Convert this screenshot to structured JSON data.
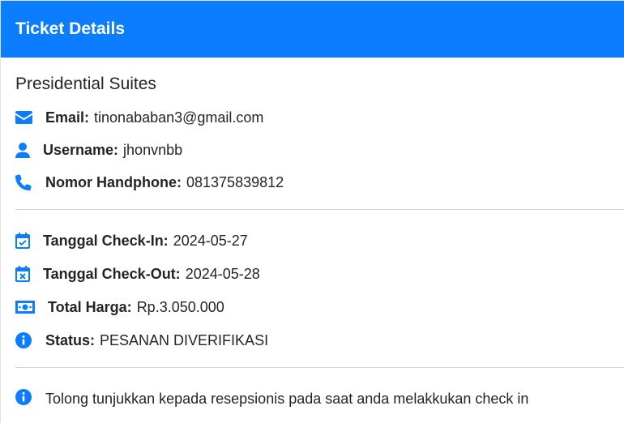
{
  "header": {
    "title": "Ticket Details"
  },
  "hotel": {
    "name": "Presidential Suites"
  },
  "contact": [
    {
      "icon": "envelope-icon",
      "label": "Email:",
      "value": "tinonababan3@gmail.com"
    },
    {
      "icon": "user-icon",
      "label": "Username:",
      "value": "jhonvnbb"
    },
    {
      "icon": "phone-icon",
      "label": "Nomor Handphone:",
      "value": "081375839812"
    }
  ],
  "booking": [
    {
      "icon": "calendar-check-icon",
      "label": "Tanggal Check-In:",
      "value": "2024-05-27"
    },
    {
      "icon": "calendar-x-icon",
      "label": "Tanggal Check-Out:",
      "value": "2024-05-28"
    },
    {
      "icon": "money-bill-icon",
      "label": "Total Harga:",
      "value": "Rp.3.050.000"
    },
    {
      "icon": "info-circle-icon",
      "label": "Status:",
      "value": "PESANAN DIVERIFIKASI"
    }
  ],
  "note": {
    "icon": "info-circle-icon",
    "text": "Tolong tunjukkan kepada resepsionis pada saat anda melakkukan check in"
  },
  "colors": {
    "accent": "#0d7dff",
    "text": "#212529",
    "divider": "#d6d6d6"
  }
}
